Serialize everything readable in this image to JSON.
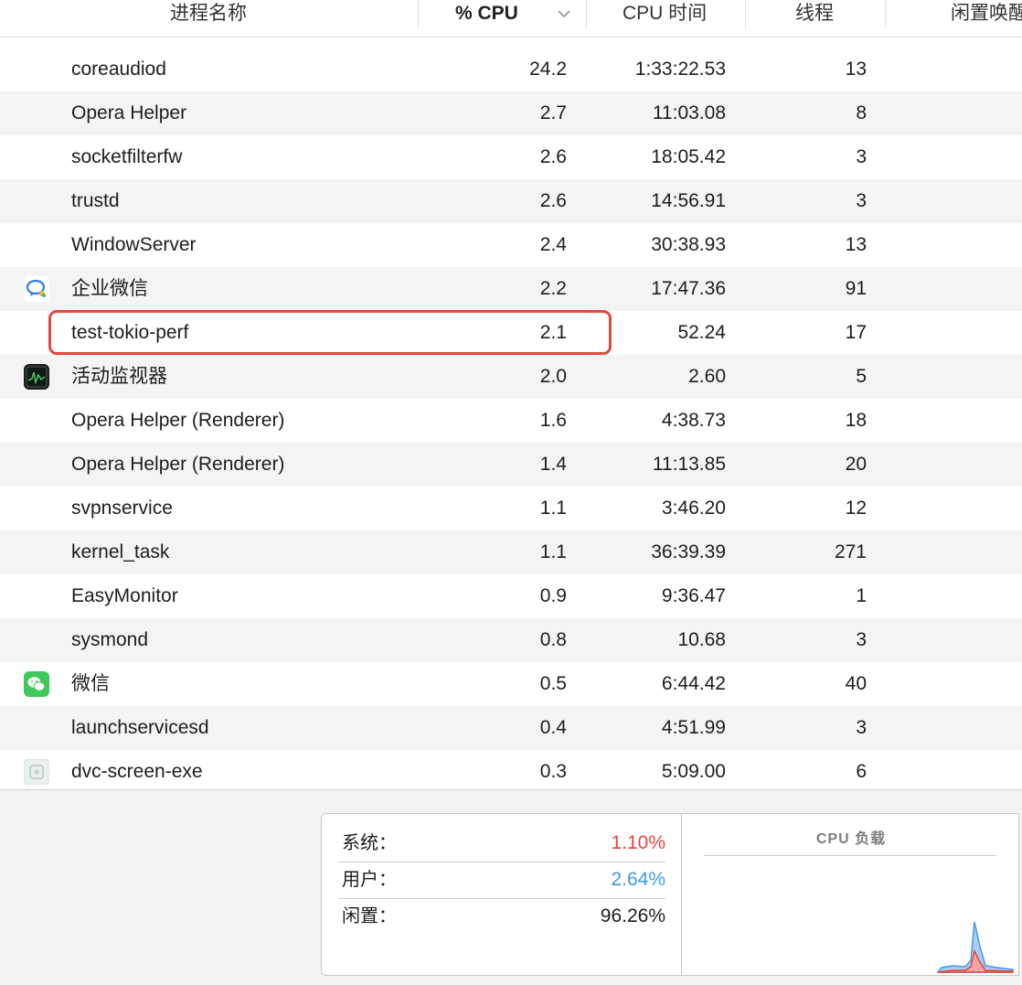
{
  "columns": {
    "name": "进程名称",
    "cpu": "% CPU",
    "cpu_time": "CPU 时间",
    "threads": "线程",
    "idle_wakeups": "闲置唤醒"
  },
  "processes": [
    {
      "name": "coreaudiod",
      "cpu": "24.2",
      "time": "1:33:22.53",
      "threads": "13",
      "icon": ""
    },
    {
      "name": "Opera Helper",
      "cpu": "2.7",
      "time": "11:03.08",
      "threads": "8",
      "icon": ""
    },
    {
      "name": "socketfilterfw",
      "cpu": "2.6",
      "time": "18:05.42",
      "threads": "3",
      "icon": ""
    },
    {
      "name": "trustd",
      "cpu": "2.6",
      "time": "14:56.91",
      "threads": "3",
      "icon": ""
    },
    {
      "name": "WindowServer",
      "cpu": "2.4",
      "time": "30:38.93",
      "threads": "13",
      "icon": ""
    },
    {
      "name": "企业微信",
      "cpu": "2.2",
      "time": "17:47.36",
      "threads": "91",
      "icon": "wecom-icon"
    },
    {
      "name": "test-tokio-perf",
      "cpu": "2.1",
      "time": "52.24",
      "threads": "17",
      "icon": ""
    },
    {
      "name": "活动监视器",
      "cpu": "2.0",
      "time": "2.60",
      "threads": "5",
      "icon": "activity-monitor-icon"
    },
    {
      "name": "Opera Helper (Renderer)",
      "cpu": "1.6",
      "time": "4:38.73",
      "threads": "18",
      "icon": ""
    },
    {
      "name": "Opera Helper (Renderer)",
      "cpu": "1.4",
      "time": "11:13.85",
      "threads": "20",
      "icon": ""
    },
    {
      "name": "svpnservice",
      "cpu": "1.1",
      "time": "3:46.20",
      "threads": "12",
      "icon": ""
    },
    {
      "name": "kernel_task",
      "cpu": "1.1",
      "time": "36:39.39",
      "threads": "271",
      "icon": ""
    },
    {
      "name": "EasyMonitor",
      "cpu": "0.9",
      "time": "9:36.47",
      "threads": "1",
      "icon": ""
    },
    {
      "name": "sysmond",
      "cpu": "0.8",
      "time": "10.68",
      "threads": "3",
      "icon": ""
    },
    {
      "name": "微信",
      "cpu": "0.5",
      "time": "6:44.42",
      "threads": "40",
      "icon": "wechat-icon"
    },
    {
      "name": "launchservicesd",
      "cpu": "0.4",
      "time": "4:51.99",
      "threads": "3",
      "icon": ""
    },
    {
      "name": "dvc-screen-exe",
      "cpu": "0.3",
      "time": "5:09.00",
      "threads": "6",
      "icon": "dvc-screen-icon"
    }
  ],
  "highlighted_process": "test-tokio-perf",
  "summary": {
    "system_label": "系统：",
    "system_value": "1.10%",
    "user_label": "用户：",
    "user_value": "2.64%",
    "idle_label": "闲置：",
    "idle_value": "96.26%"
  },
  "graph": {
    "title": "CPU 负载"
  },
  "colors": {
    "system": "#e8443a",
    "user": "#3d9be9",
    "highlight": "#e5473d",
    "alt_row": "#f4f4f5"
  }
}
